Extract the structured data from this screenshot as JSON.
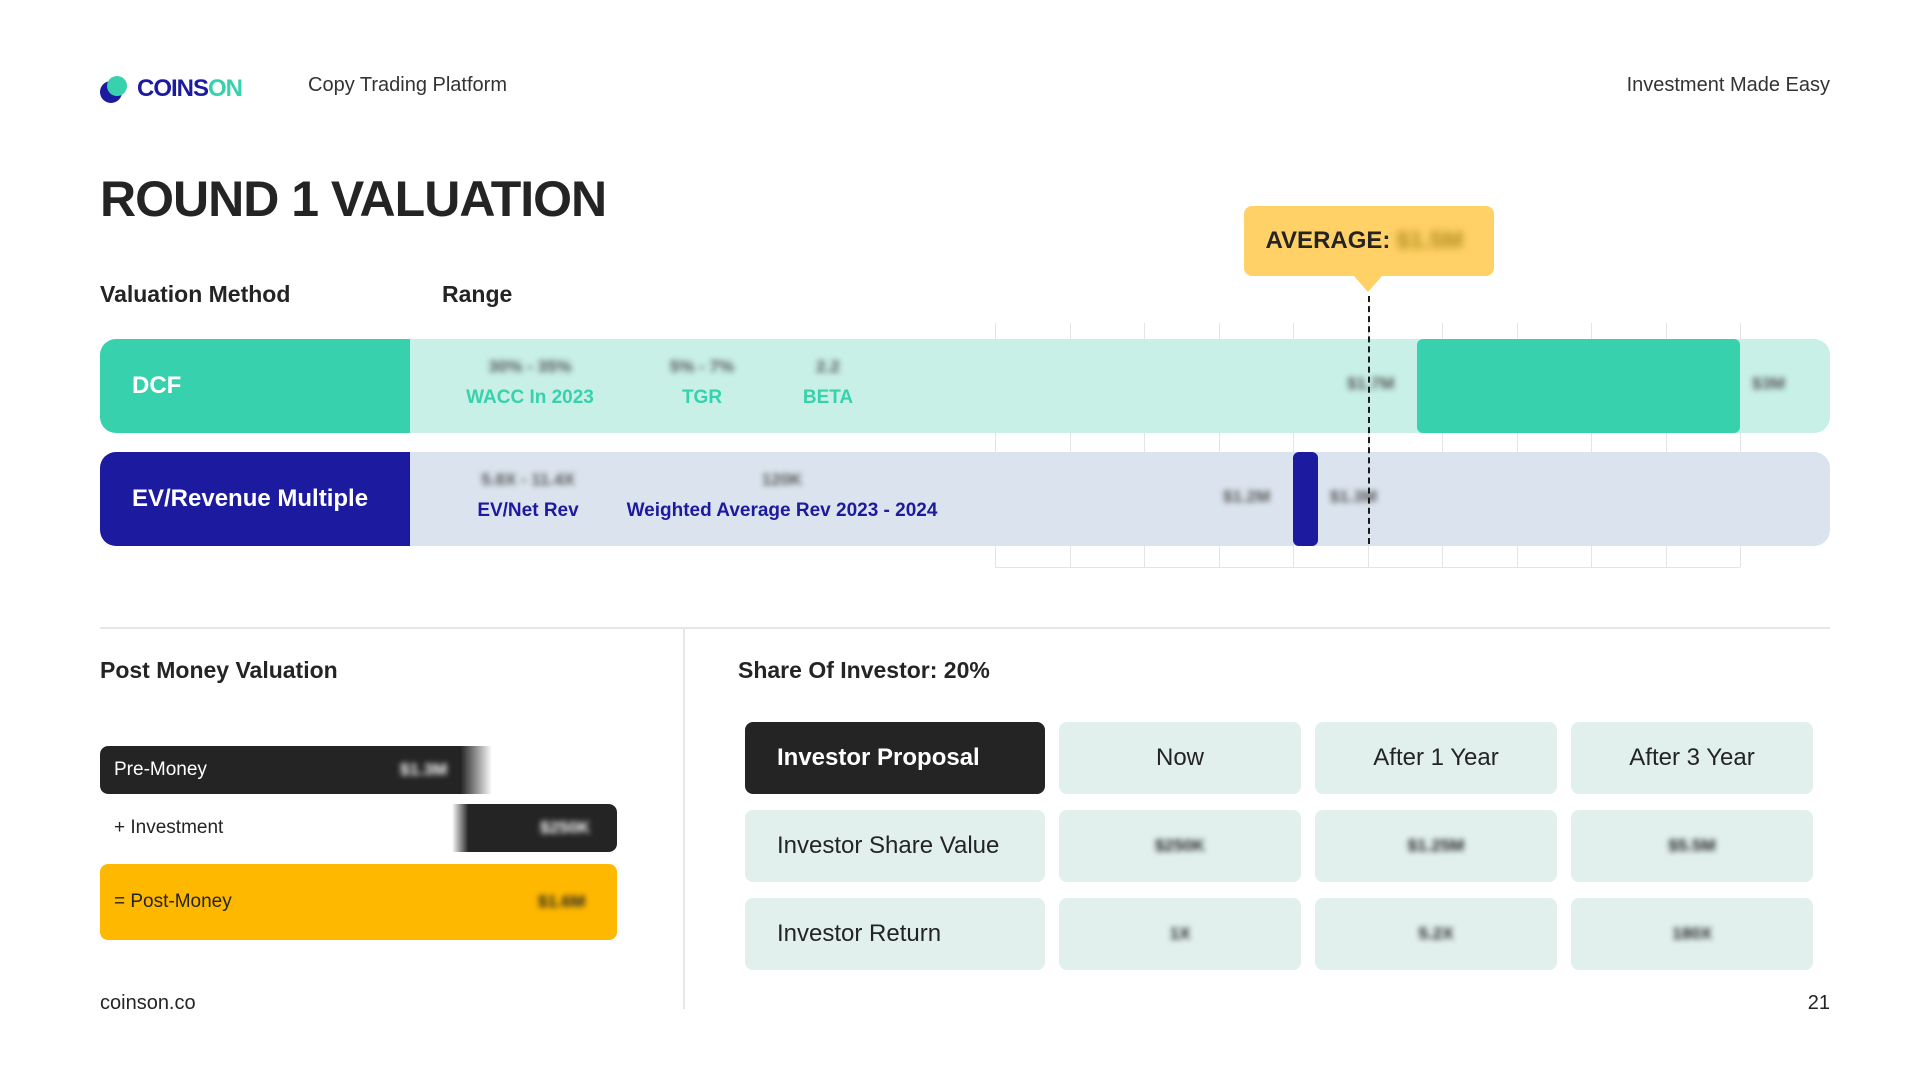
{
  "header": {
    "brand_part1": "COINS",
    "brand_part2": "ON",
    "tagline": "Copy Trading Platform",
    "right_text": "Investment Made Easy"
  },
  "title": "ROUND 1 VALUATION",
  "columns": {
    "method": "Valuation Method",
    "range": "Range"
  },
  "average": {
    "label": "AVERAGE:",
    "value": "$1.5M"
  },
  "rows": [
    {
      "label": "DCF",
      "colors": {
        "label_bg": "#38d1ad",
        "track_bg": "#c8f0e6",
        "bar": "#38d1ad",
        "text": "#38d1ad"
      },
      "params": [
        {
          "value": "30% - 35%",
          "label": "WACC In 2023"
        },
        {
          "value": "5% - 7%",
          "label": "TGR"
        },
        {
          "value": "2.2",
          "label": "BETA"
        }
      ],
      "range_low": "$1.7M",
      "range_high": "$3M"
    },
    {
      "label": "EV/Revenue Multiple",
      "colors": {
        "label_bg": "#1c1a9e",
        "track_bg": "#dbe4ee",
        "bar": "#1c1a9e",
        "text": "#1c1a9e"
      },
      "params": [
        {
          "value": "5.8X - 11.4X",
          "label": "EV/Net Rev"
        },
        {
          "value": "120K",
          "label": "Weighted Average Rev 2023 - 2024"
        }
      ],
      "range_low": "$1.2M",
      "range_high": "$1.3M"
    }
  ],
  "post_money": {
    "title": "Post Money Valuation",
    "pre_label": "Pre-Money",
    "pre_value": "$1.3M",
    "inv_label": "+ Investment",
    "inv_value": "$250K",
    "post_label": "= Post-Money",
    "post_value": "$1.6M"
  },
  "investor": {
    "title": "Share Of Investor: 20%",
    "header_label": "Investor Proposal",
    "columns": [
      "Now",
      "After 1 Year",
      "After 3 Year"
    ],
    "rows": [
      {
        "label": "Investor Share Value",
        "values": [
          "$250K",
          "$1.25M",
          "$5.5M"
        ]
      },
      {
        "label": "Investor Return",
        "values": [
          "1X",
          "5.2X",
          "180X"
        ]
      }
    ]
  },
  "footer": {
    "website": "coinson.co",
    "page_number": "21"
  },
  "chart_data": {
    "type": "bar",
    "orientation": "horizontal-range",
    "categories": [
      "DCF",
      "EV/Revenue Multiple"
    ],
    "series": [
      {
        "name": "DCF",
        "low": 1.7,
        "high": 3.0
      },
      {
        "name": "EV/Revenue Multiple",
        "low": 1.2,
        "high": 1.3
      }
    ],
    "average": 1.5,
    "xlim": [
      0,
      3.0
    ],
    "grid": true
  }
}
